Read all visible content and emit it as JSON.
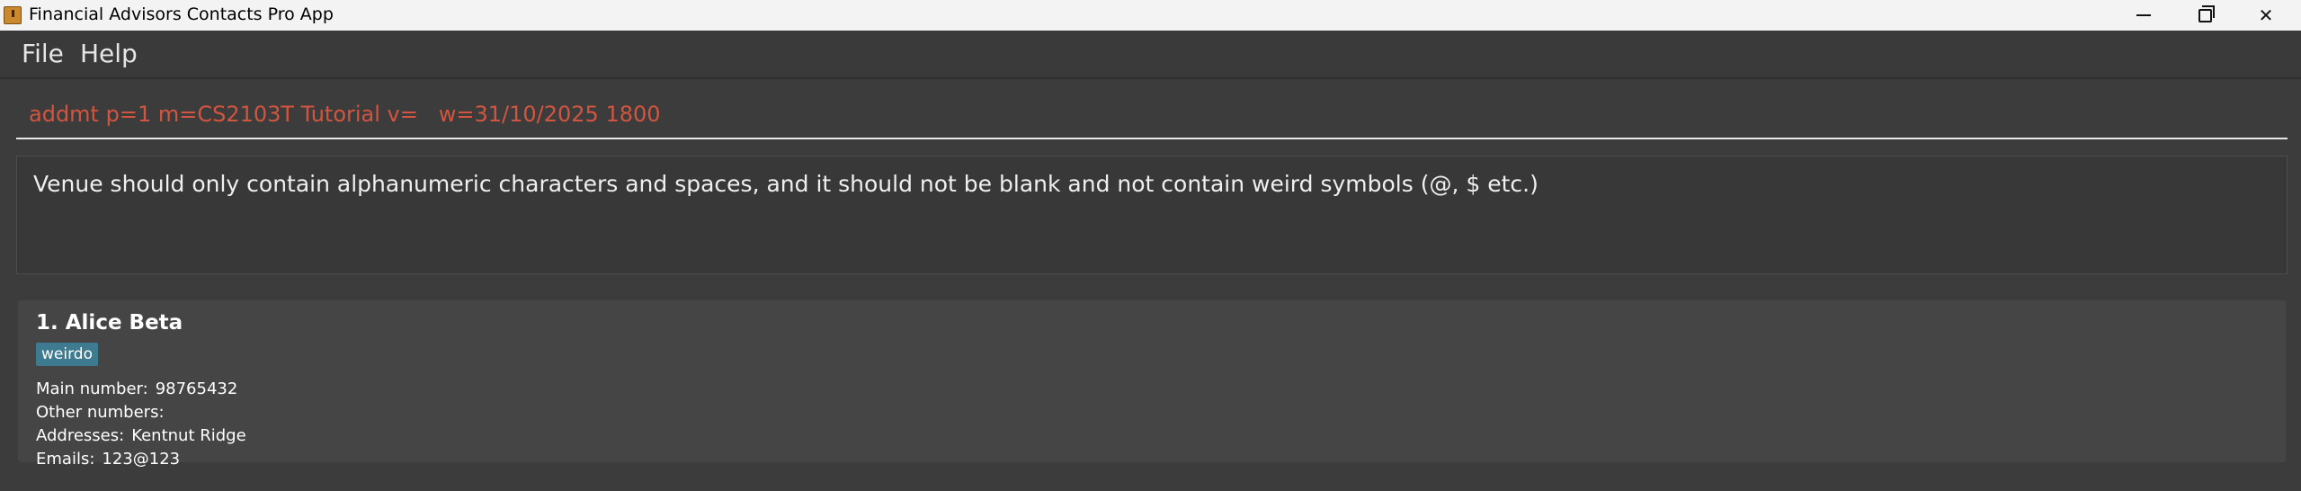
{
  "window": {
    "title": "Financial Advisors Contacts Pro App",
    "icon": "app-icon",
    "controls": [
      "minimize-icon",
      "maximize-icon",
      "close-icon"
    ]
  },
  "menu": {
    "file_label": "File",
    "help_label": "Help"
  },
  "command": {
    "value": "addmt p=1 m=CS2103T Tutorial v=   w=31/10/2025 1800",
    "error_color": "#d2553f"
  },
  "result": {
    "message": "Venue should only contain alphanumeric characters and spaces, and it should not be blank and not contain weird symbols (@, $ etc.)"
  },
  "persons": [
    {
      "index_name": "1. Alice Beta",
      "tags": [
        "weirdo"
      ],
      "main_number_label": "Main number:",
      "main_number": "98765432",
      "other_numbers_label": "Other numbers:",
      "other_numbers": "",
      "addresses_label": "Addresses:",
      "addresses": "Kentnut Ridge",
      "emails_label": "Emails:",
      "emails": "123@123"
    }
  ],
  "colors": {
    "background": "#3c3c3c",
    "tag": "#3e7b91",
    "card": "#454545"
  }
}
